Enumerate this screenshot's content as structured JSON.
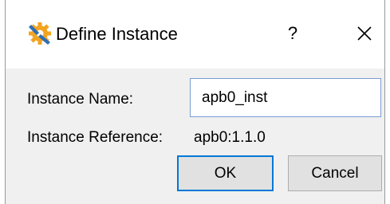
{
  "window": {
    "title": "Define Instance",
    "app_icon": "gear-wrench-icon",
    "help_glyph": "?",
    "close_icon": "close-icon"
  },
  "form": {
    "name_label": "Instance Name:",
    "name_value": "apb0_inst",
    "reference_label": "Instance Reference:",
    "reference_value": "apb0:1.1.0"
  },
  "buttons": {
    "ok_label": "OK",
    "cancel_label": "Cancel"
  },
  "colors": {
    "accent": "#0078d7",
    "dialog_bg": "#f0f0f0",
    "icon_blue": "#2f6fb5",
    "icon_orange": "#f2a31f"
  }
}
